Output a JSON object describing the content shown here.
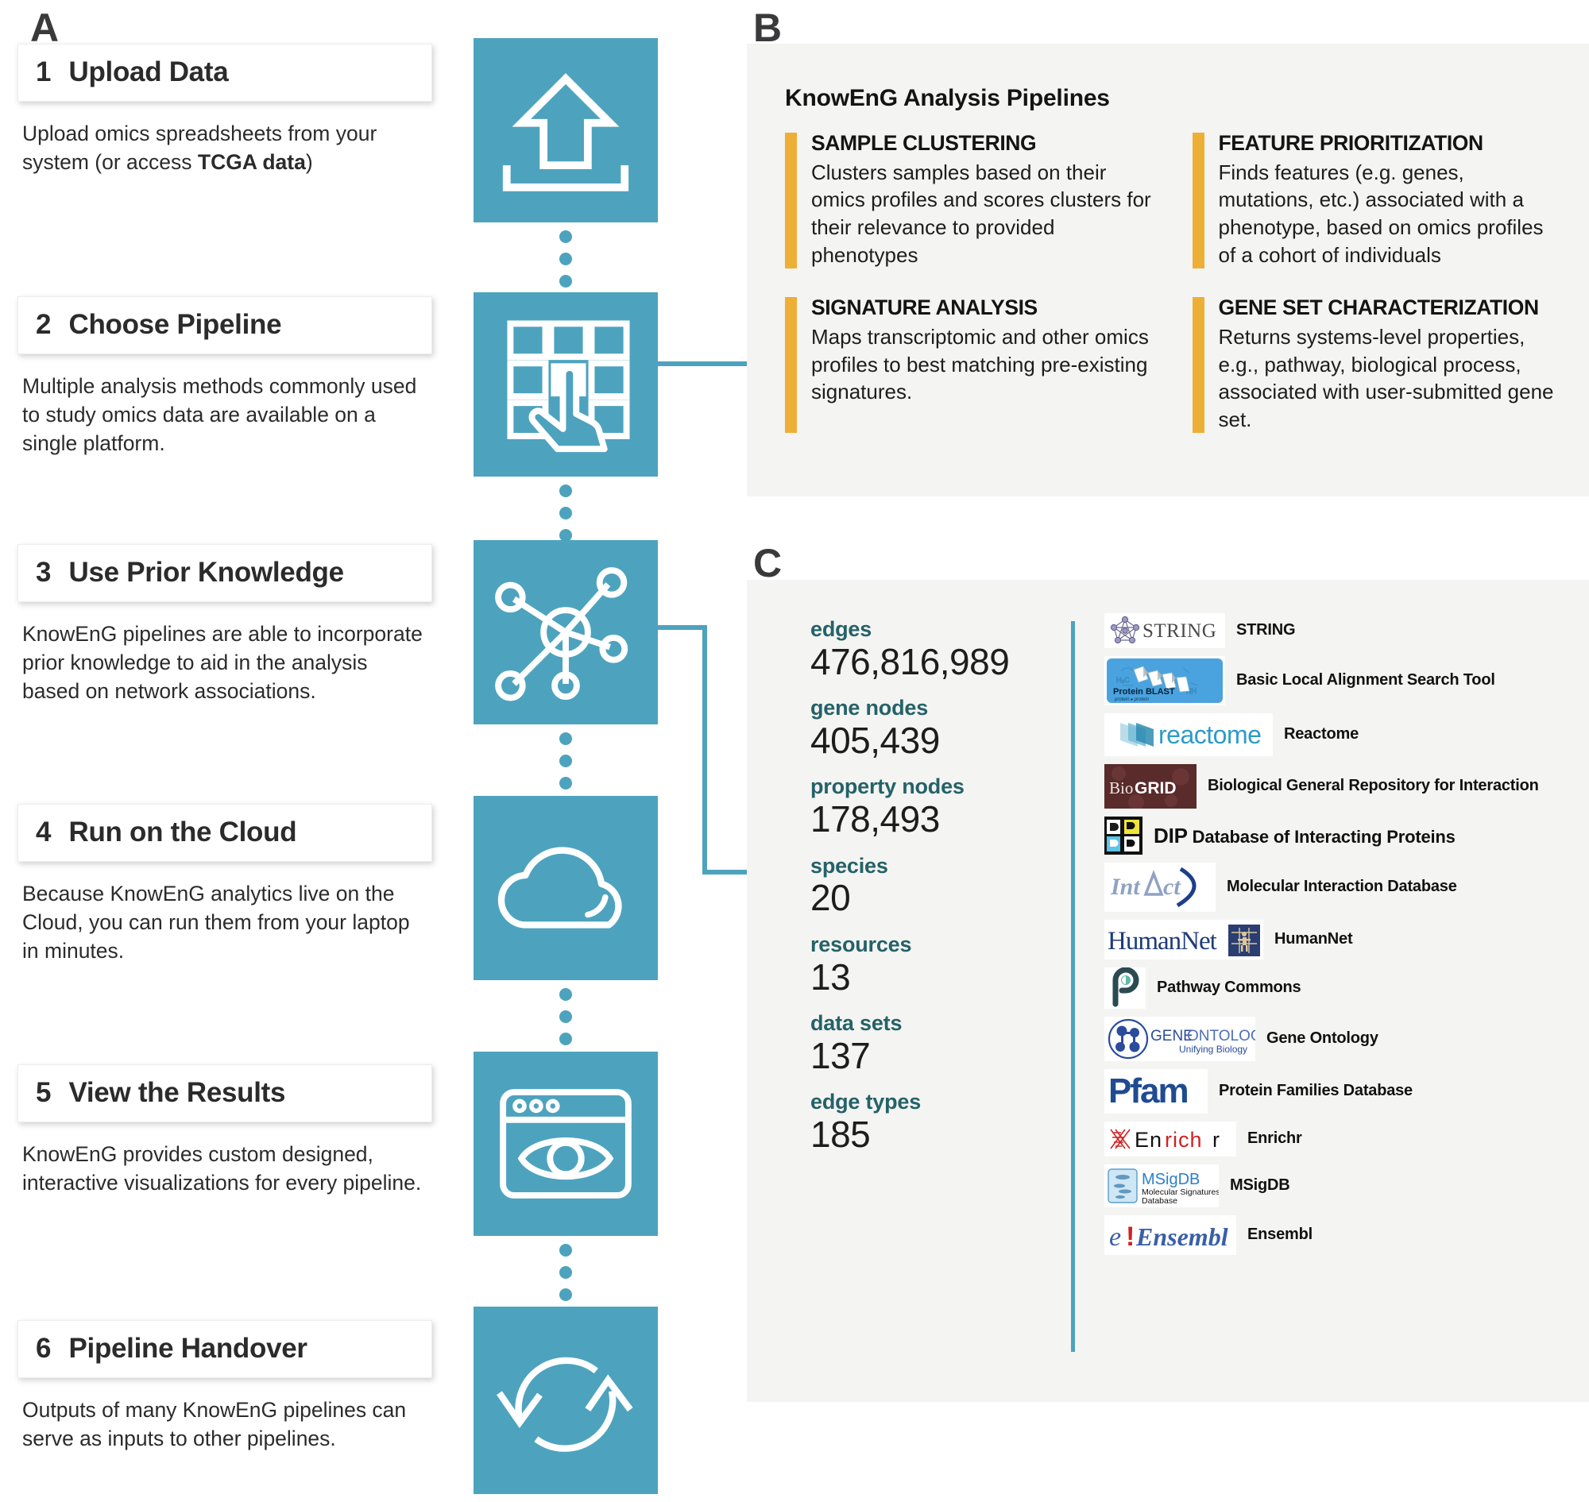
{
  "panels": {
    "a": "A",
    "b": "B",
    "c": "C"
  },
  "steps": [
    {
      "num": "1",
      "title": "Upload Data",
      "desc_before": "Upload omics spreadsheets from your system (or access ",
      "desc_bold": "TCGA data",
      "desc_after": ")",
      "icon": "upload-icon"
    },
    {
      "num": "2",
      "title": "Choose Pipeline",
      "desc_before": "Multiple analysis methods commonly used to study omics data are available on a single platform.",
      "desc_bold": "",
      "desc_after": "",
      "icon": "grid-tap-icon"
    },
    {
      "num": "3",
      "title": "Use Prior Knowledge",
      "desc_before": "KnowEnG pipelines are able to incorporate prior knowledge to aid in the analysis based on network associations.",
      "desc_bold": "",
      "desc_after": "",
      "icon": "network-icon"
    },
    {
      "num": "4",
      "title": "Run on the Cloud",
      "desc_before": "Because KnowEnG analytics live on the Cloud, you can run them from your laptop in minutes.",
      "desc_bold": "",
      "desc_after": "",
      "icon": "cloud-icon"
    },
    {
      "num": "5",
      "title": "View the Results",
      "desc_before": "KnowEnG provides custom designed, interactive visualizations for every pipeline.",
      "desc_bold": "",
      "desc_after": "",
      "icon": "browser-eye-icon"
    },
    {
      "num": "6",
      "title": "Pipeline Handover",
      "desc_before": "Outputs of many KnowEnG pipelines can serve as inputs to other pipelines.",
      "desc_bold": "",
      "desc_after": "",
      "icon": "refresh-cycle-icon"
    }
  ],
  "pipelines_panel": {
    "title": "KnowEnG Analysis Pipelines",
    "items": [
      {
        "name": "SAMPLE CLUSTERING",
        "text": "Clusters samples based on their omics profiles and scores clusters for their relevance to provided phenotypes"
      },
      {
        "name": "FEATURE PRIORITIZATION",
        "text": "Finds features (e.g. genes, mutations, etc.) associated with a phenotype, based on omics profiles of a cohort of individuals"
      },
      {
        "name": "SIGNATURE ANALYSIS",
        "text": "Maps transcriptomic and other omics profiles to best matching pre-existing signatures."
      },
      {
        "name": "GENE SET CHARACTERIZATION",
        "text": "Returns systems-level properties, e.g., pathway, biological process, associated with user-submitted gene set."
      }
    ]
  },
  "knowledge_network": {
    "stats": [
      {
        "label": "edges",
        "value": "476,816,989"
      },
      {
        "label": "gene nodes",
        "value": "405,439"
      },
      {
        "label": "property nodes",
        "value": "178,493"
      },
      {
        "label": "species",
        "value": "20"
      },
      {
        "label": "resources",
        "value": "13"
      },
      {
        "label": "data sets",
        "value": "137"
      },
      {
        "label": "edge types",
        "value": "185"
      }
    ],
    "resources": [
      {
        "logo_text": "STRING",
        "name": "STRING",
        "logo": "string-logo"
      },
      {
        "logo_text": "Protein BLAST",
        "name": "Basic Local Alignment Search Tool",
        "logo": "blast-logo"
      },
      {
        "logo_text": "reactome",
        "name": "Reactome",
        "logo": "reactome-logo"
      },
      {
        "logo_text": "BioGRID",
        "name": "Biological General Repository for Interaction",
        "logo": "biogrid-logo"
      },
      {
        "logo_text": "DIP",
        "name": "Database of Interacting Proteins",
        "logo": "dip-logo"
      },
      {
        "logo_text": "IntAct",
        "name": "Molecular Interaction Database",
        "logo": "intact-logo"
      },
      {
        "logo_text": "HumanNet",
        "name": "HumanNet",
        "logo": "humannet-logo"
      },
      {
        "logo_text": "Pathway Commons",
        "name": "Pathway Commons",
        "logo": "pathwaycommons-logo"
      },
      {
        "logo_text": "GENEONTOLOGY Unifying Biology",
        "name": "Gene Ontology",
        "logo": "geneontology-logo"
      },
      {
        "logo_text": "Pfam",
        "name": "Protein Families Database",
        "logo": "pfam-logo"
      },
      {
        "logo_text": "Enrichr",
        "name": "Enrichr",
        "logo": "enrichr-logo"
      },
      {
        "logo_text": "MSigDB Molecular Signatures Database",
        "name": "MSigDB",
        "logo": "msigdb-logo"
      },
      {
        "logo_text": "e!Ensembl",
        "name": "Ensembl",
        "logo": "ensembl-logo"
      }
    ]
  },
  "colors": {
    "teal": "#4da3be",
    "orange": "#eeaf36",
    "panel_bg": "#f4f4f2",
    "stat_label": "#246268"
  }
}
